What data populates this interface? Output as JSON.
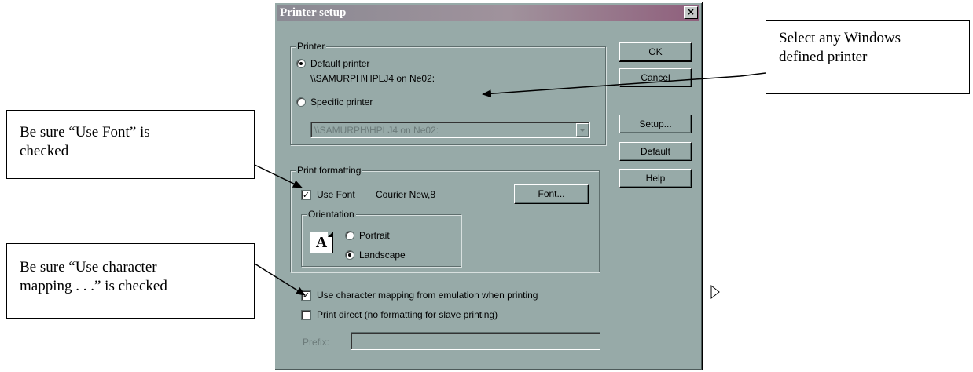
{
  "dialog": {
    "title": "Printer setup",
    "close_label": "×",
    "printer": {
      "group_label": "Printer",
      "default_label": "Default printer",
      "default_name": "\\\\SAMURPH\\HPLJ4 on Ne02:",
      "specific_label": "Specific printer",
      "specific_value": "\\\\SAMURPH\\HPLJ4 on Ne02:",
      "selected": "default"
    },
    "buttons": {
      "ok": "OK",
      "cancel": "Cancel",
      "setup": "Setup...",
      "default": "Default",
      "help": "Help"
    },
    "print_formatting": {
      "group_label": "Print formatting",
      "use_font_label": "Use Font",
      "use_font_checked": true,
      "font_value": "Courier New,8",
      "font_button": "Font...",
      "orientation": {
        "group_label": "Orientation",
        "icon_letter": "A",
        "portrait_label": "Portrait",
        "landscape_label": "Landscape",
        "selected": "landscape"
      }
    },
    "char_mapping_label": "Use character mapping from emulation when printing",
    "char_mapping_checked": true,
    "print_direct_label": "Print direct (no formatting for slave printing)",
    "print_direct_checked": false,
    "prefix_label": "Prefix:",
    "prefix_value": ""
  },
  "callouts": {
    "printer": {
      "line1": "Select any Windows",
      "line2": "defined printer"
    },
    "use_font": {
      "line1": "Be sure “Use Font” is",
      "line2": "checked"
    },
    "char_mapping": {
      "line1": "Be sure “Use character",
      "line2": "mapping . . .” is checked"
    }
  },
  "colors": {
    "dialog_face": "#97aaa8",
    "title_gradient_end": "#8f5f7c"
  }
}
